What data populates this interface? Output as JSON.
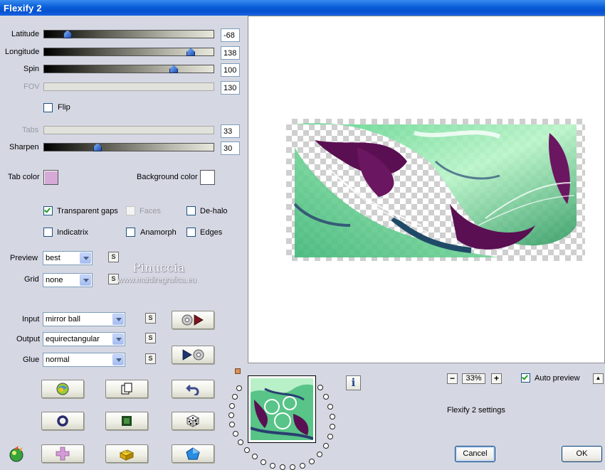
{
  "window": {
    "title": "Flexify 2"
  },
  "sliders": [
    {
      "key": "latitude",
      "label": "Latitude",
      "value": "-68",
      "position": 0.14,
      "enabled": true
    },
    {
      "key": "longitude",
      "label": "Longitude",
      "value": "138",
      "position": 0.86,
      "enabled": true
    },
    {
      "key": "spin",
      "label": "Spin",
      "value": "100",
      "position": 0.77,
      "enabled": true
    },
    {
      "key": "fov",
      "label": "FOV",
      "value": "130",
      "enabled": false
    },
    {
      "key": "tabs",
      "label": "Tabs",
      "value": "33",
      "enabled": false
    },
    {
      "key": "sharpen",
      "label": "Sharpen",
      "value": "30",
      "position": 0.31,
      "enabled": true
    }
  ],
  "flip": {
    "label": "Flip",
    "checked": false
  },
  "colors": {
    "tab_label": "Tab color",
    "tab_color": "#d7a9d7",
    "background_label": "Background color",
    "background_color": "#ffffff"
  },
  "options": {
    "transparent_gaps": {
      "label": "Transparent gaps",
      "checked": true
    },
    "faces": {
      "label": "Faces",
      "checked": false,
      "enabled": false
    },
    "de_halo": {
      "label": "De-halo",
      "checked": false
    },
    "indicatrix": {
      "label": "Indicatrix",
      "checked": false
    },
    "anamorph": {
      "label": "Anamorph",
      "checked": false
    },
    "edges": {
      "label": "Edges",
      "checked": false
    }
  },
  "selects": {
    "preview": {
      "label": "Preview",
      "value": "best"
    },
    "grid": {
      "label": "Grid",
      "value": "none"
    },
    "input": {
      "label": "Input",
      "value": "mirror ball"
    },
    "output": {
      "label": "Output",
      "value": "equirectangular"
    },
    "glue": {
      "label": "Glue",
      "value": "normal"
    }
  },
  "s_button_label": "S",
  "watermark": {
    "name": "Pinuccia",
    "site": "www.maidiregrafica.eu"
  },
  "zoom": {
    "minus": "−",
    "value": "33%",
    "plus": "+"
  },
  "auto_preview": {
    "label": "Auto preview",
    "checked": true
  },
  "scroll_up_label": "▲",
  "status_text": "Flexify 2 settings",
  "info_label": "i",
  "buttons": {
    "cancel": "Cancel",
    "ok": "OK"
  },
  "accent": {
    "slider_thumb": "#3a6fd0",
    "check": "#21a121",
    "xp_blue": "#0a5ed8"
  }
}
